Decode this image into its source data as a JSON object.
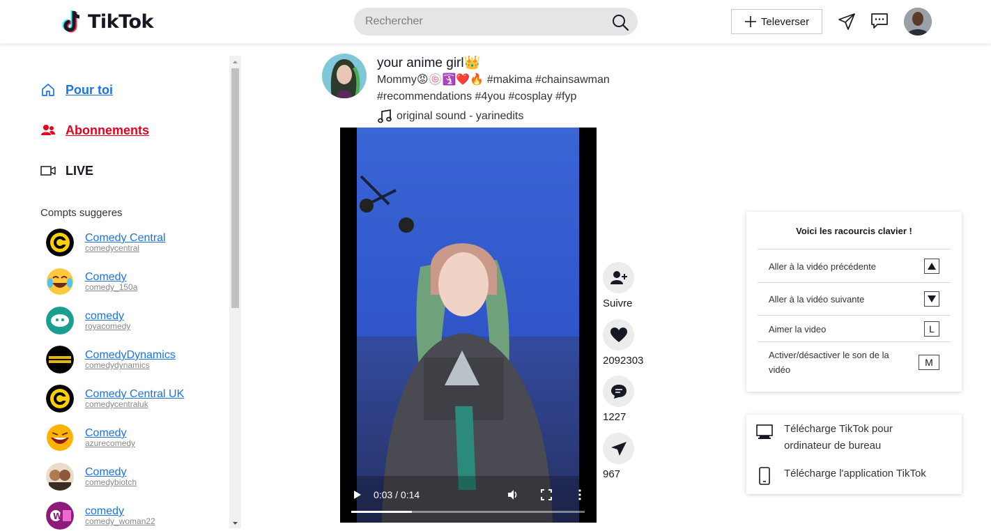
{
  "header": {
    "logo_text": "TikTok",
    "search_placeholder": "Rechercher",
    "upload_label": "Televerser"
  },
  "sidebar": {
    "nav": [
      {
        "label": "Pour toi",
        "icon": "home-icon"
      },
      {
        "label": "Abonnements",
        "icon": "users-icon"
      },
      {
        "label": "LIVE",
        "icon": "video-camera-icon"
      }
    ],
    "suggested_title": "Compts suggeres",
    "accounts": [
      {
        "name": "Comedy Central",
        "username": "comedycentral"
      },
      {
        "name": "Comedy",
        "username": "comedy_150a"
      },
      {
        "name": "comedy",
        "username": "royacomedy"
      },
      {
        "name": "ComedyDynamics",
        "username": "comedydynamics"
      },
      {
        "name": "Comedy Central UK",
        "username": "comedycentraluk"
      },
      {
        "name": "Comedy",
        "username": "azurecomedy"
      },
      {
        "name": "Comedy",
        "username": "comedybiotch"
      },
      {
        "name": "comedy",
        "username": "comedy_woman22"
      }
    ]
  },
  "post": {
    "author": "your anime girl👑",
    "description": "Mommy😡🍥🛐❤️🔥 #makima #chainsawman #recommendations #4you #cosplay #fyp",
    "sound": "original sound - yarinedits",
    "video_time": "0:03 / 0:14",
    "progress": 0.26
  },
  "actions": {
    "follow_label": "Suivre",
    "likes": "2092303",
    "comments": "1227",
    "shares": "967"
  },
  "shortcuts": {
    "title": "Voici les racourcis clavier !",
    "items": [
      {
        "label": "Aller à la vidéo précédente",
        "key": "▲"
      },
      {
        "label": "Aller à la vidéo suivante",
        "key": "▼"
      },
      {
        "label": "Aimer la video",
        "key": "L"
      },
      {
        "label": "Activer/désactiver le son de la vidéo",
        "key": "M"
      }
    ]
  },
  "downloads": {
    "desktop": "Télécharge TikTok pour ordinateur de bureau",
    "app": "Télécharge l'application TikTok"
  }
}
